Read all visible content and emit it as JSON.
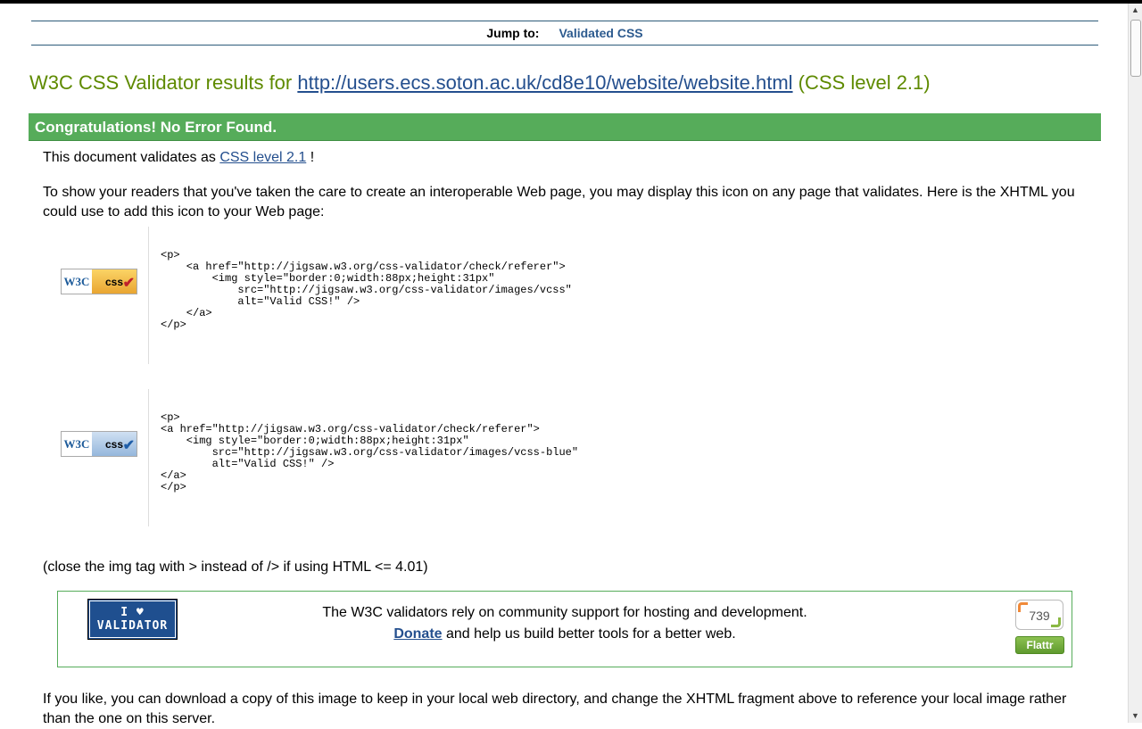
{
  "jump": {
    "label": "Jump to:",
    "link": "Validated CSS"
  },
  "header": {
    "title_prefix": "W3C CSS Validator results for ",
    "title_url": "http://users.ecs.soton.ac.uk/cd8e10/website/website.html",
    "title_suffix": " (CSS level 2.1)"
  },
  "result": {
    "banner": "Congratulations! No Error Found.",
    "validates_prefix": "This document validates as ",
    "validates_link": "CSS level 2.1",
    "validates_suffix": " !",
    "show_readers": "To show your readers that you've taken the care to create an interoperable Web page, you may display this icon on any page that validates. Here is the XHTML you could use to add this icon to your Web page:"
  },
  "badges": [
    {
      "icon": "vcss-gold-icon",
      "w3c": "W3C",
      "css": "css",
      "code": "<p>\n    <a href=\"http://jigsaw.w3.org/css-validator/check/referer\">\n        <img style=\"border:0;width:88px;height:31px\"\n            src=\"http://jigsaw.w3.org/css-validator/images/vcss\"\n            alt=\"Valid CSS!\" />\n    </a>\n</p>"
    },
    {
      "icon": "vcss-blue-icon",
      "w3c": "W3C",
      "css": "css",
      "code": "<p>\n<a href=\"http://jigsaw.w3.org/css-validator/check/referer\">\n    <img style=\"border:0;width:88px;height:31px\"\n        src=\"http://jigsaw.w3.org/css-validator/images/vcss-blue\"\n        alt=\"Valid CSS!\" />\n</a>\n</p>"
    }
  ],
  "note": "(close the img tag with > instead of /> if using HTML <= 4.01)",
  "donate": {
    "badge_line1": "I ♥",
    "badge_line2": "VALIDATOR",
    "line1": "The W3C validators rely on community support for hosting and development.",
    "donate_link": "Donate",
    "line2_suffix": " and help us build better tools for a better web.",
    "flattr_count": "739",
    "flattr_label": "Flattr"
  },
  "footer_text": "If you like, you can download a copy of this image to keep in your local web directory, and change the XHTML fragment above to reference your local image rather than the one on this server.",
  "colors": {
    "banner_green": "#56ac5a",
    "title_green": "#5e8a00",
    "link_blue": "#244f8e"
  }
}
